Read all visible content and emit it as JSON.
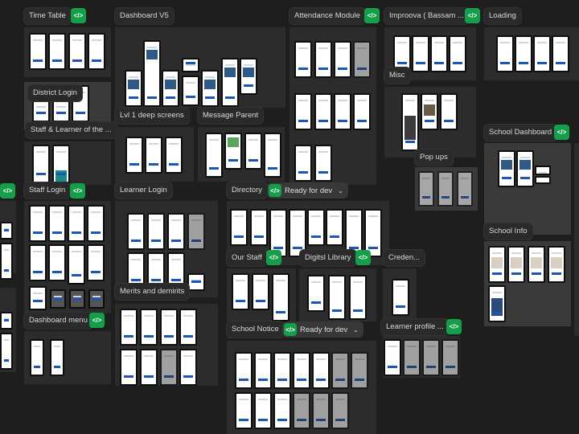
{
  "canvas": {
    "frames": [
      {
        "id": "time-table",
        "label": "Time Table",
        "has_code": true
      },
      {
        "id": "dashboard-v5",
        "label": "Dashboard V5",
        "has_code": false
      },
      {
        "id": "attendance-module",
        "label": "Attendance Module",
        "has_code": true
      },
      {
        "id": "improova",
        "label": "Improova ( Bassam ...",
        "has_code": true
      },
      {
        "id": "loading",
        "label": "Loading",
        "has_code": false
      },
      {
        "id": "district-login",
        "label": "District Login",
        "has_code": false
      },
      {
        "id": "staff-learner",
        "label": "Staff & Learner of the ...",
        "has_code": false
      },
      {
        "id": "lvl1-deep",
        "label": "Lvl 1 deep screens",
        "has_code": false
      },
      {
        "id": "message-parent",
        "label": "Message Parent",
        "has_code": false
      },
      {
        "id": "misc",
        "label": "Misc",
        "has_code": false
      },
      {
        "id": "school-dashboard",
        "label": "School Dashboard",
        "has_code": true
      },
      {
        "id": "pop-ups",
        "label": "Pop ups",
        "has_code": false
      },
      {
        "id": "staff-login",
        "label": "Staff Login",
        "has_code": true
      },
      {
        "id": "learner-login",
        "label": "Learner Login",
        "has_code": false
      },
      {
        "id": "directory",
        "label": "Directory",
        "has_code": false,
        "status": "Ready for dev"
      },
      {
        "id": "school-info",
        "label": "School Info",
        "has_code": false
      },
      {
        "id": "our-staff",
        "label": "Our Staff",
        "has_code": true
      },
      {
        "id": "digital-library",
        "label": "Digitsl Library",
        "has_code": true
      },
      {
        "id": "credentials",
        "label": "Creden...",
        "has_code": false
      },
      {
        "id": "merits",
        "label": "Merits and demirits",
        "has_code": false
      },
      {
        "id": "dashboard-menu",
        "label": "Dashboard menu",
        "has_code": true
      },
      {
        "id": "school-notice",
        "label": "School Notice",
        "has_code": false,
        "status": "Ready for dev"
      },
      {
        "id": "learner-profile",
        "label": "Learner profile ...",
        "has_code": true
      }
    ],
    "code_icon": "</>",
    "status_chevron": "⌄",
    "colors": {
      "canvas": "#1e1e1e",
      "section": "#2c2c2c",
      "code_badge": "#14a04a"
    }
  }
}
